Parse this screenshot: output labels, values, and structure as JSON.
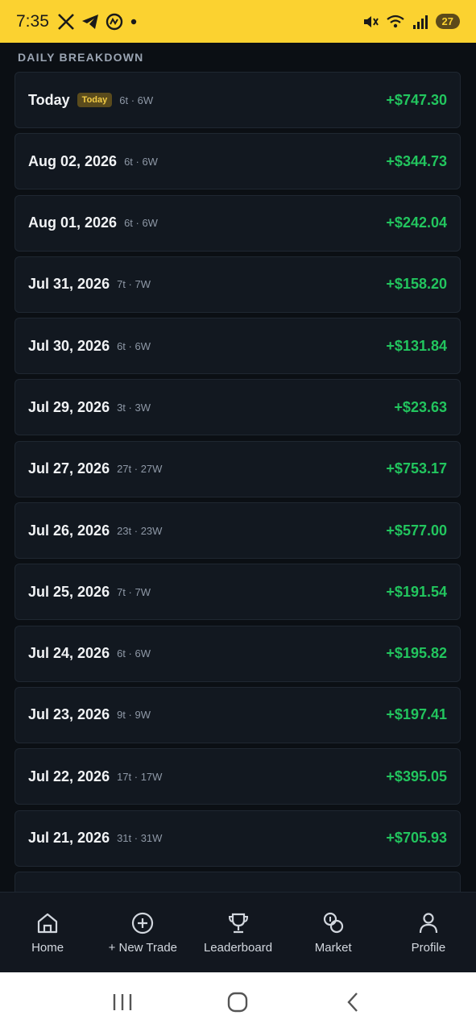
{
  "status_bar": {
    "time": "7:35",
    "battery": "27"
  },
  "section_title": "DAILY BREAKDOWN",
  "days": [
    {
      "date": "Today",
      "badge": "Today",
      "meta": "6t · 6W",
      "amount": "+$747.30"
    },
    {
      "date": "Aug 02, 2026",
      "meta": "6t · 6W",
      "amount": "+$344.73"
    },
    {
      "date": "Aug 01, 2026",
      "meta": "6t · 6W",
      "amount": "+$242.04"
    },
    {
      "date": "Jul 31, 2026",
      "meta": "7t · 7W",
      "amount": "+$158.20"
    },
    {
      "date": "Jul 30, 2026",
      "meta": "6t · 6W",
      "amount": "+$131.84"
    },
    {
      "date": "Jul 29, 2026",
      "meta": "3t · 3W",
      "amount": "+$23.63"
    },
    {
      "date": "Jul 27, 2026",
      "meta": "27t · 27W",
      "amount": "+$753.17"
    },
    {
      "date": "Jul 26, 2026",
      "meta": "23t · 23W",
      "amount": "+$577.00"
    },
    {
      "date": "Jul 25, 2026",
      "meta": "7t · 7W",
      "amount": "+$191.54"
    },
    {
      "date": "Jul 24, 2026",
      "meta": "6t · 6W",
      "amount": "+$195.82"
    },
    {
      "date": "Jul 23, 2026",
      "meta": "9t · 9W",
      "amount": "+$197.41"
    },
    {
      "date": "Jul 22, 2026",
      "meta": "17t · 17W",
      "amount": "+$395.05"
    },
    {
      "date": "Jul 21, 2026",
      "meta": "31t · 31W",
      "amount": "+$705.93"
    },
    {
      "date": "",
      "meta": "",
      "amount": ""
    }
  ],
  "nav": {
    "home": "Home",
    "new_trade": "+ New Trade",
    "leaderboard": "Leaderboard",
    "market": "Market",
    "profile": "Profile"
  },
  "colors": {
    "accent_yellow": "#fbd230",
    "profit_green": "#22c55e",
    "background": "#0b0f14",
    "card": "#121820"
  }
}
